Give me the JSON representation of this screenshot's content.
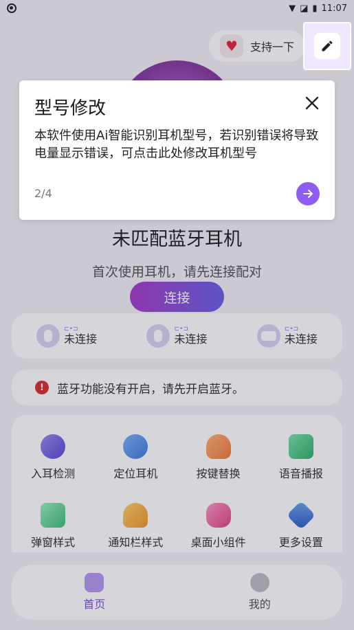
{
  "status_bar": {
    "time": "11:07"
  },
  "header": {
    "support_label": "支持一下",
    "heart_icon": "heart-icon",
    "edit_icon": "pencil-icon"
  },
  "device": {
    "title": "未匹配蓝牙耳机",
    "subtitle": "首次使用耳机，请先连接配对",
    "connect_label": "连接"
  },
  "buds": [
    {
      "link": "⊏•⊐",
      "status": "未连接",
      "icon": "left-earbud-icon"
    },
    {
      "link": "⊏•⊐",
      "status": "未连接",
      "icon": "right-earbud-icon"
    },
    {
      "link": "⊏•⊐",
      "status": "未连接",
      "icon": "case-icon"
    }
  ],
  "warning": {
    "text": "蓝牙功能没有开启，请先开启蓝牙。"
  },
  "features": [
    {
      "label": "入耳检测"
    },
    {
      "label": "定位耳机"
    },
    {
      "label": "按键替换"
    },
    {
      "label": "语音播报"
    },
    {
      "label": "弹窗样式"
    },
    {
      "label": "通知栏样式"
    },
    {
      "label": "桌面小组件"
    },
    {
      "label": "更多设置"
    }
  ],
  "tabs": [
    {
      "label": "首页"
    },
    {
      "label": "我的"
    }
  ],
  "dialog": {
    "title": "型号修改",
    "body": "本软件使用Ai智能识别耳机型号，若识别错误将导致电量显示错误，可点击此处修改耳机型号",
    "step": "2/4"
  },
  "colors": {
    "accent": "#8e5cf0",
    "warning": "#d8302c"
  }
}
